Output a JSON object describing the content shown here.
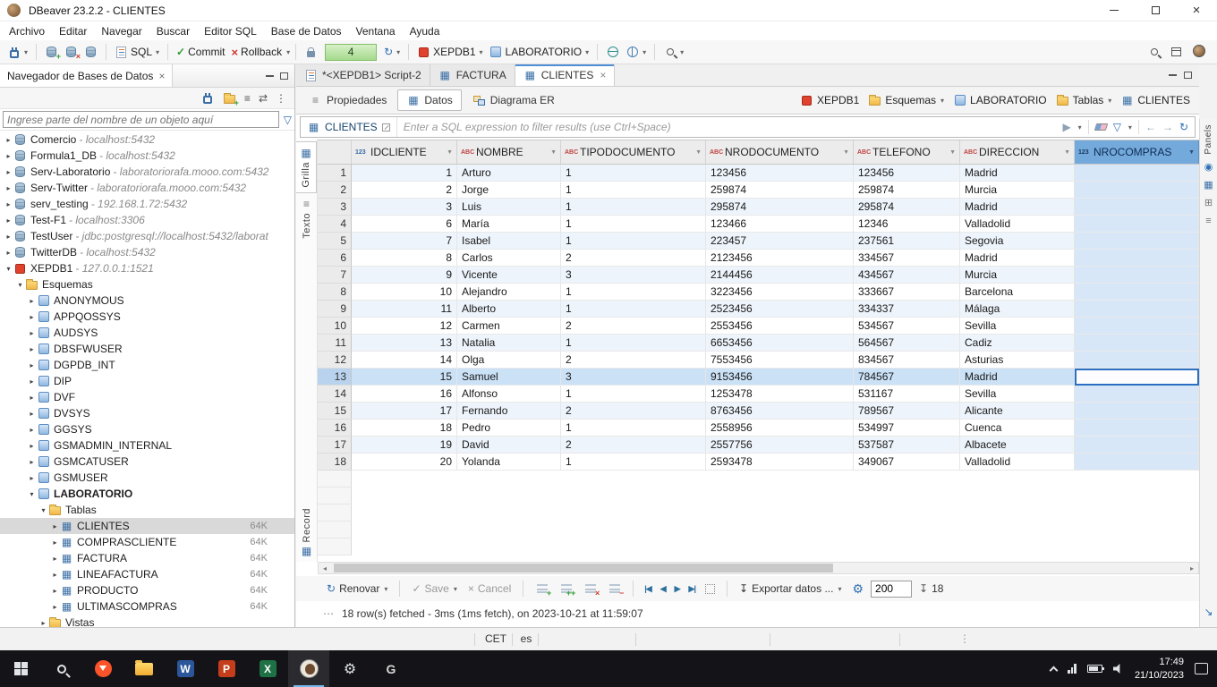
{
  "titlebar": {
    "title": "DBeaver 23.2.2 - CLIENTES"
  },
  "menubar": {
    "items": [
      "Archivo",
      "Editar",
      "Navegar",
      "Buscar",
      "Editor SQL",
      "Base de Datos",
      "Ventana",
      "Ayuda"
    ]
  },
  "toolbar": {
    "sql_label": "SQL",
    "commit_label": "Commit",
    "rollback_label": "Rollback",
    "tx_count": "4",
    "connection": "XEPDB1",
    "schema": "LABORATORIO"
  },
  "navigator": {
    "title": "Navegador de Bases de Datos",
    "search_placeholder": "Ingrese parte del nombre de un objeto aquí",
    "tree": [
      {
        "label": "Comercio",
        "suffix": " - localhost:5432",
        "level": 0,
        "type": "db",
        "chev": "right"
      },
      {
        "label": "Formula1_DB",
        "suffix": " - localhost:5432",
        "level": 0,
        "type": "db",
        "chev": "right"
      },
      {
        "label": "Serv-Laboratorio",
        "suffix": " - laboratoriorafa.mooo.com:5432",
        "level": 0,
        "type": "db",
        "chev": "right"
      },
      {
        "label": "Serv-Twitter",
        "suffix": " - laboratoriorafa.mooo.com:5432",
        "level": 0,
        "type": "db",
        "chev": "right"
      },
      {
        "label": "serv_testing",
        "suffix": " - 192.168.1.72:5432",
        "level": 0,
        "type": "db",
        "chev": "right"
      },
      {
        "label": "Test-F1",
        "suffix": " - localhost:3306",
        "level": 0,
        "type": "db",
        "chev": "right"
      },
      {
        "label": "TestUser",
        "suffix": " - jdbc:postgresql://localhost:5432/laborat",
        "level": 0,
        "type": "db",
        "chev": "right"
      },
      {
        "label": "TwitterDB",
        "suffix": " - localhost:5432",
        "level": 0,
        "type": "db",
        "chev": "right"
      },
      {
        "label": "XEPDB1",
        "suffix": " - 127.0.0.1:1521",
        "level": 0,
        "type": "oracle",
        "chev": "down"
      },
      {
        "label": "Esquemas",
        "level": 1,
        "type": "folder",
        "chev": "down"
      },
      {
        "label": "ANONYMOUS",
        "level": 2,
        "type": "schema",
        "chev": "right"
      },
      {
        "label": "APPQOSSYS",
        "level": 2,
        "type": "schema",
        "chev": "right"
      },
      {
        "label": "AUDSYS",
        "level": 2,
        "type": "schema",
        "chev": "right"
      },
      {
        "label": "DBSFWUSER",
        "level": 2,
        "type": "schema",
        "chev": "right"
      },
      {
        "label": "DGPDB_INT",
        "level": 2,
        "type": "schema",
        "chev": "right"
      },
      {
        "label": "DIP",
        "level": 2,
        "type": "schema",
        "chev": "right"
      },
      {
        "label": "DVF",
        "level": 2,
        "type": "schema",
        "chev": "right"
      },
      {
        "label": "DVSYS",
        "level": 2,
        "type": "schema",
        "chev": "right"
      },
      {
        "label": "GGSYS",
        "level": 2,
        "type": "schema",
        "chev": "right"
      },
      {
        "label": "GSMADMIN_INTERNAL",
        "level": 2,
        "type": "schema",
        "chev": "right"
      },
      {
        "label": "GSMCATUSER",
        "level": 2,
        "type": "schema",
        "chev": "right"
      },
      {
        "label": "GSMUSER",
        "level": 2,
        "type": "schema",
        "chev": "right"
      },
      {
        "label": "LABORATORIO",
        "level": 2,
        "type": "schema",
        "chev": "down",
        "bold": true
      },
      {
        "label": "Tablas",
        "level": 3,
        "type": "folder",
        "chev": "down"
      },
      {
        "label": "CLIENTES",
        "size": "64K",
        "level": 4,
        "type": "table",
        "chev": "right",
        "selected": true
      },
      {
        "label": "COMPRASCLIENTE",
        "size": "64K",
        "level": 4,
        "type": "table",
        "chev": "right"
      },
      {
        "label": "FACTURA",
        "size": "64K",
        "level": 4,
        "type": "table",
        "chev": "right"
      },
      {
        "label": "LINEAFACTURA",
        "size": "64K",
        "level": 4,
        "type": "table",
        "chev": "right"
      },
      {
        "label": "PRODUCTO",
        "size": "64K",
        "level": 4,
        "type": "table",
        "chev": "right"
      },
      {
        "label": "ULTIMASCOMPRAS",
        "size": "64K",
        "level": 4,
        "type": "table",
        "chev": "right"
      },
      {
        "label": "Vistas",
        "level": 3,
        "type": "folder",
        "chev": "right"
      }
    ]
  },
  "editor_tabs": {
    "tabs": [
      {
        "label": "*<XEPDB1> Script-2",
        "icon": "script",
        "active": false,
        "closable": false
      },
      {
        "label": "FACTURA",
        "icon": "table",
        "active": false,
        "closable": false
      },
      {
        "label": "CLIENTES",
        "icon": "table",
        "active": true,
        "closable": true
      }
    ]
  },
  "view_tabs": {
    "tabs": [
      {
        "label": "Propiedades",
        "icon": "props",
        "active": false
      },
      {
        "label": "Datos",
        "icon": "grid",
        "active": true
      },
      {
        "label": "Diagrama ER",
        "icon": "er",
        "active": false
      }
    ]
  },
  "breadcrumb": {
    "items": [
      {
        "label": "XEPDB1",
        "icon": "oracle",
        "dropdown": false
      },
      {
        "label": "Esquemas",
        "icon": "folder",
        "dropdown": true
      },
      {
        "label": "LABORATORIO",
        "icon": "schema",
        "dropdown": false
      },
      {
        "label": "Tablas",
        "icon": "folder",
        "dropdown": true
      },
      {
        "label": "CLIENTES",
        "icon": "table",
        "dropdown": false
      }
    ]
  },
  "filter_bar": {
    "table": "CLIENTES",
    "placeholder": "Enter a SQL expression to filter results (use Ctrl+Space)"
  },
  "side_tabs": {
    "grilla": "Grilla",
    "texto": "Texto",
    "record": "Record",
    "panels": "Panels"
  },
  "grid": {
    "columns": [
      {
        "name": "IDCLIENTE",
        "type": "123",
        "selected": false
      },
      {
        "name": "NOMBRE",
        "type": "ABC",
        "selected": false
      },
      {
        "name": "TIPODOCUMENTO",
        "type": "ABC",
        "selected": false
      },
      {
        "name": "NRODOCUMENTO",
        "type": "ABC",
        "selected": false
      },
      {
        "name": "TELEFONO",
        "type": "ABC",
        "selected": false
      },
      {
        "name": "DIRECCION",
        "type": "ABC",
        "selected": false
      },
      {
        "name": "NROCOMPRAS",
        "type": "123",
        "selected": true
      }
    ],
    "rows": [
      [
        "1",
        "1",
        "Arturo",
        "1",
        "123456",
        "123456",
        "Madrid",
        ""
      ],
      [
        "2",
        "2",
        "Jorge",
        "1",
        "259874",
        "259874",
        "Murcia",
        ""
      ],
      [
        "3",
        "3",
        "Luis",
        "1",
        "295874",
        "295874",
        "Madrid",
        ""
      ],
      [
        "4",
        "6",
        "María",
        "1",
        "123466",
        "12346",
        "Valladolid",
        ""
      ],
      [
        "5",
        "7",
        "Isabel",
        "1",
        "223457",
        "237561",
        "Segovia",
        ""
      ],
      [
        "6",
        "8",
        "Carlos",
        "2",
        "2123456",
        "334567",
        "Madrid",
        ""
      ],
      [
        "7",
        "9",
        "Vicente",
        "3",
        "2144456",
        "434567",
        "Murcia",
        ""
      ],
      [
        "8",
        "10",
        "Alejandro",
        "1",
        "3223456",
        "333667",
        "Barcelona",
        ""
      ],
      [
        "9",
        "11",
        "Alberto",
        "1",
        "2523456",
        "334337",
        "Málaga",
        ""
      ],
      [
        "10",
        "12",
        "Carmen",
        "2",
        "2553456",
        "534567",
        "Sevilla",
        ""
      ],
      [
        "11",
        "13",
        "Natalia",
        "1",
        "6653456",
        "564567",
        "Cadiz",
        ""
      ],
      [
        "12",
        "14",
        "Olga",
        "2",
        "7553456",
        "834567",
        "Asturias",
        ""
      ],
      [
        "13",
        "15",
        "Samuel",
        "3",
        "9153456",
        "784567",
        "Madrid",
        ""
      ],
      [
        "14",
        "16",
        "Alfonso",
        "1",
        "1253478",
        "531167",
        "Sevilla",
        ""
      ],
      [
        "15",
        "17",
        "Fernando",
        "2",
        "8763456",
        "789567",
        "Alicante",
        ""
      ],
      [
        "16",
        "18",
        "Pedro",
        "1",
        "2558956",
        "534997",
        "Cuenca",
        ""
      ],
      [
        "17",
        "19",
        "David",
        "2",
        "2557756",
        "537587",
        "Albacete",
        ""
      ],
      [
        "18",
        "20",
        "Yolanda",
        "1",
        "2593478",
        "349067",
        "Valladolid",
        ""
      ]
    ],
    "selection": {
      "row_index": 12,
      "column": "NROCOMPRAS"
    }
  },
  "result_toolbar": {
    "refresh_label": "Renovar",
    "save_label": "Save",
    "cancel_label": "Cancel",
    "export_label": "Exportar datos ...",
    "fetch_size": "200",
    "row_count": "18"
  },
  "status_line": {
    "text": "18 row(s) fetched - 3ms (1ms fetch), on 2023-10-21 at 11:59:07"
  },
  "statusbar": {
    "timezone": "CET",
    "locale": "es"
  },
  "taskbar": {
    "clock_time": "17:49",
    "clock_date": "21/10/2023",
    "word_letter": "W",
    "powerpoint_letter": "P",
    "excel_letter": "X",
    "geforce_letter": "G"
  },
  "icons": {
    "chevron_collapsed": "▸",
    "chevron_expanded": "▾",
    "dropdown_arrow": "▾",
    "sort_arrow": "▼",
    "close": "×",
    "check": "✓",
    "cross": "×",
    "refresh": "↻",
    "link_editor": "⇄",
    "collapse_all": "≡",
    "menu_dots": "⋮",
    "play": "▶",
    "funnel": "▽",
    "arrow_left": "←",
    "arrow_right": "→",
    "export_arrow": "↧",
    "gear": "⚙",
    "table_glyph": "▦",
    "text_glyph": "≡",
    "ellipsis": "⋯",
    "nav_first": "|◀",
    "nav_prev": "◀",
    "nav_next": "▶",
    "nav_last": "▶|",
    "scroll_left": "◂",
    "scroll_right": "▸",
    "panel_dot": "◉",
    "panel_grid": "▦",
    "panel_plus": "⊞",
    "panel_lines": "≡",
    "maximize_arrow": "↘"
  }
}
